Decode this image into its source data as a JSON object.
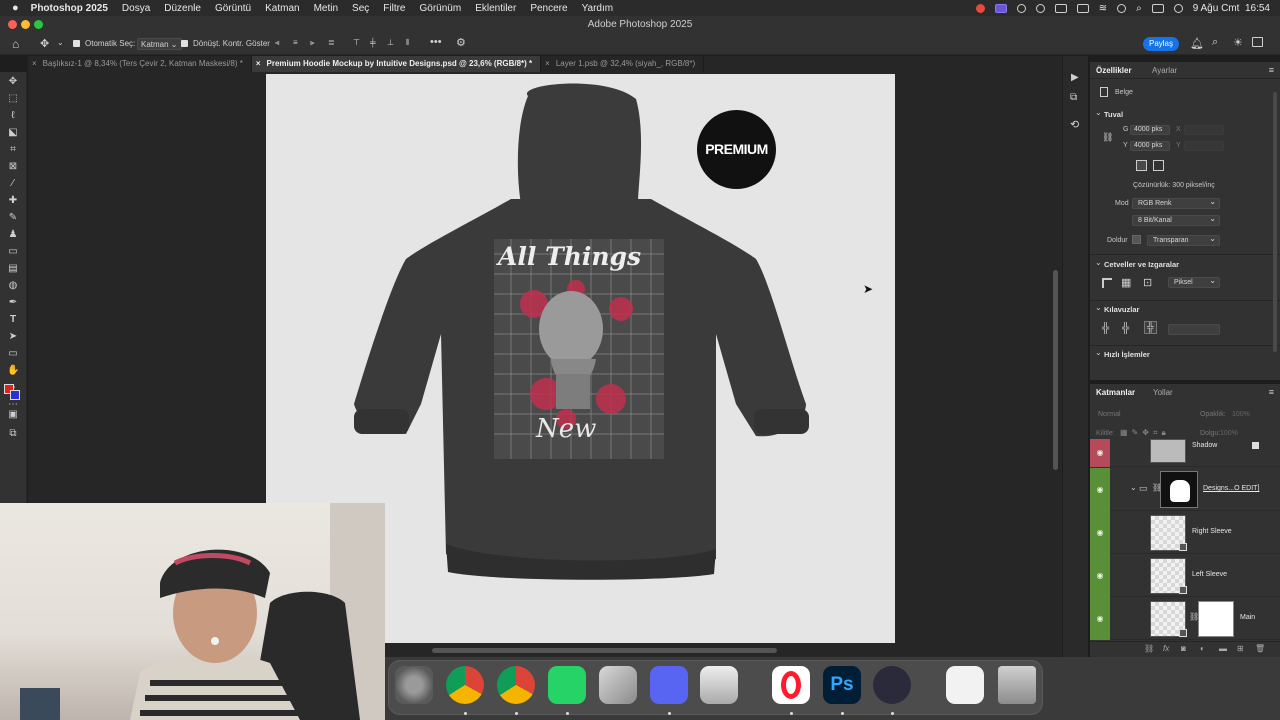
{
  "menubar": {
    "app_name": "Photoshop 2025",
    "menus": [
      "Dosya",
      "Düzenle",
      "Görüntü",
      "Katman",
      "Metin",
      "Seç",
      "Filtre",
      "Görünüm",
      "Eklentiler",
      "Pencere",
      "Yardım"
    ],
    "clock": "9 Ağu Cmt  16:54"
  },
  "window": {
    "title": "Adobe Photoshop 2025"
  },
  "options": {
    "auto_select_label": "Otomatik Seç:",
    "auto_select_value": "Katman",
    "transform_controls_label": "Dönüşt. Kontr. Göster",
    "share_label": "Paylaş"
  },
  "tabs": [
    {
      "label": "Başlıksız-1 @ 8,34% (Ters Çevir 2, Katman Maskesi/8) *",
      "active": false
    },
    {
      "label": "Premium Hoodie Mockup by Intuitive Designs.psd @ 23,6% (RGB/8*) *",
      "active": true
    },
    {
      "label": "Layer 1.psb @ 32,4% (siyah_, RGB/8*)",
      "active": false
    }
  ],
  "canvas": {
    "badge_text": "PREMIUM",
    "design_line1": "All Things",
    "design_line2": "New"
  },
  "properties": {
    "tab_properties": "Özellikler",
    "tab_adjustments": "Ayarlar",
    "doc_label": "Belge",
    "canvas_section": "Tuval",
    "width_label": "G",
    "width_value": "4000 pks",
    "height_label": "Y",
    "height_value": "4000 pks",
    "x_label": "X",
    "y_label": "Y",
    "resolution": "Çözünürlük: 300 piksel/inç",
    "mode_label": "Mod",
    "mode_value": "RGB Renk",
    "bit_value": "8 Bit/Kanal",
    "fill_label": "Doldur",
    "fill_value": "Transparan",
    "rulers_section": "Cetveller ve Izgaralar",
    "units_value": "Piksel",
    "guides_section": "Kılavuzlar",
    "quick_actions_section": "Hızlı İşlemler"
  },
  "layers": {
    "tab_layers": "Katmanlar",
    "tab_paths": "Yollar",
    "blend_mode": "Normal",
    "opacity_label": "Opaklık:",
    "opacity_value": "100%",
    "lock_label": "Kilitle:",
    "fill_label": "Dolgu:",
    "fill_value": "100%",
    "items": [
      {
        "name": "Shadow"
      },
      {
        "name": "Designs...O EDIT]"
      },
      {
        "name": "Right Sleeve"
      },
      {
        "name": "Left Sleeve"
      },
      {
        "name": "Main"
      }
    ]
  },
  "dock": {
    "apps": [
      "System Settings",
      "Chrome",
      "Chrome Canary",
      "WhatsApp",
      "iPhone Mirroring",
      "Discord",
      "Printer",
      "Opera",
      "Photoshop",
      "OBS",
      "Preview",
      "Trash"
    ],
    "photoshop_label": "Ps"
  },
  "colors": {
    "accent": "#1473e6",
    "layer_visible": "#5a8f3a",
    "layer_selected": "#b44a5a",
    "foreground": "#e0231a",
    "background": "#2a2fd6"
  }
}
